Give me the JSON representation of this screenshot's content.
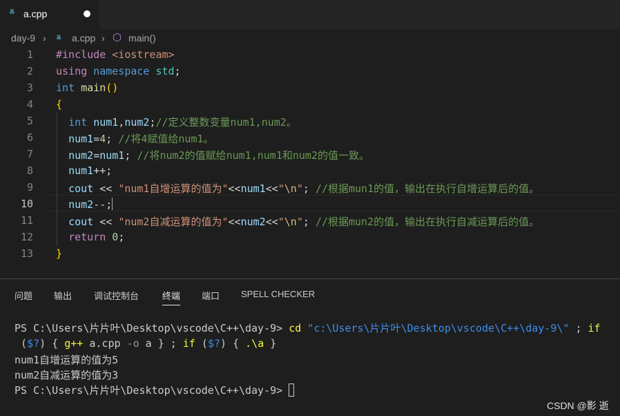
{
  "tab": {
    "title": "a.cpp",
    "icon": "cpp-file-icon",
    "unsaved": true
  },
  "breadcrumb": {
    "folder": "day-9",
    "file": "a.cpp",
    "symbol": "main()"
  },
  "editor": {
    "line_numbers": [
      "1",
      "2",
      "3",
      "4",
      "5",
      "6",
      "7",
      "8",
      "9",
      "10",
      "11",
      "12",
      "13"
    ],
    "active_line": "10",
    "lines": [
      "#include <iostream>",
      "using namespace std;",
      "int main()",
      "{",
      "  int num1,num2;//定义整数变量num1,num2。",
      "  num1=4; //将4赋值给num1。",
      "  num2=num1; //将num2的值赋给num1,num1和num2的值一致。",
      "  num1++;",
      "  cout << \"num1自增运算的值为\"<<num1<<\"\\n\"; //根据mun1的值，输出在执行自增运算后的值。",
      "  num2--;",
      "  cout << \"num2自减运算的值为\"<<num2<<\"\\n\"; //根据mun2的值，输出在执行自减运算后的值。",
      "  return 0;",
      "}"
    ]
  },
  "panel": {
    "tabs": [
      "问题",
      "输出",
      "调试控制台",
      "终端",
      "端口",
      "SPELL CHECKER"
    ],
    "active_tab": "终端"
  },
  "terminal": {
    "prompt": "PS C:\\Users\\片片叶\\Desktop\\vscode\\C++\\day-9>",
    "cmd_cd": "cd",
    "cmd_path": "\"c:\\Users\\片片叶\\Desktop\\vscode\\C++\\day-9\\\"",
    "cmd_sep1": " ; ",
    "cmd_if": "if",
    "cmd_line2_open": " (",
    "cmd_var": "$?",
    "cmd_line2_mid": ") { ",
    "cmd_gpp": "g++",
    "cmd_gpp_args": " a.cpp ",
    "cmd_opt": "-o",
    "cmd_tail1": " a } ; ",
    "cmd_if2": "if",
    "cmd_tail2": " (",
    "cmd_var2": "$?",
    "cmd_tail3": ") { ",
    "cmd_run": ".\\a",
    "cmd_tail4": " }",
    "output": [
      "num1自增运算的值为5",
      "num2自减运算的值为3"
    ]
  },
  "watermark": "CSDN @影 逝"
}
